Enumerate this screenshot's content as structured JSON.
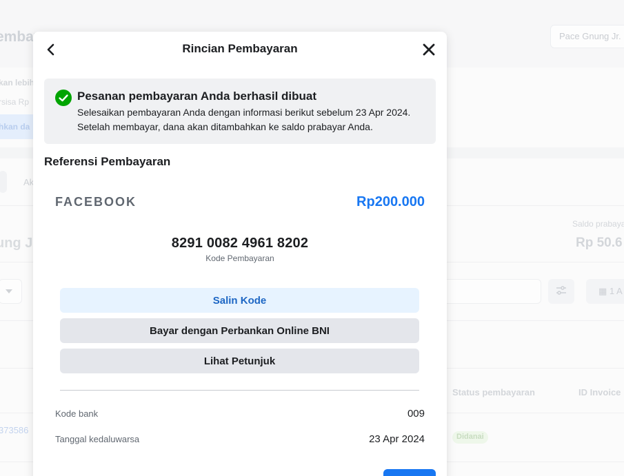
{
  "background": {
    "page_title": "embayaran",
    "user_name": "Pace Gnung Jr.",
    "notice_title": "kan lebih",
    "notice_text": "rsisa Rp",
    "notice_button": "hkan da",
    "tab_label": "Ak",
    "account_name": "ung J",
    "balance_label": "Saldo prabayar",
    "balance_value": "Rp 50.6",
    "date_filter": "1 A",
    "table_headers": [
      "Status pembayaran",
      "ID Invoice"
    ],
    "row_id": "373586",
    "row_status": "Didanai"
  },
  "modal": {
    "title": "Rincian Pembayaran",
    "success": {
      "title": "Pesanan pembayaran Anda berhasil dibuat",
      "text": "Selesaikan pembayaran Anda dengan informasi berikut sebelum 23 Apr 2024. Setelah membayar, dana akan ditambahkan ke saldo prabayar Anda."
    },
    "reference_heading": "Referensi Pembayaran",
    "merchant": "FACEBOOK",
    "amount": "Rp200.000",
    "payment_code": "8291 0082 4961 8202",
    "payment_code_label": "Kode Pembayaran",
    "buttons": {
      "copy": "Salin Kode",
      "bank": "Bayar dengan Perbankan Online BNI",
      "guide": "Lihat Petunjuk"
    },
    "details": [
      {
        "label": "Kode bank",
        "value": "009"
      },
      {
        "label": "Tanggal kedaluwarsa",
        "value": "23 Apr 2024"
      }
    ]
  },
  "colors": {
    "accent": "#1877f2",
    "success": "#00a400",
    "copy_button_bg": "#e7f3ff",
    "secondary_button_bg": "#e4e6eb"
  },
  "icons": {
    "back": "chevron-left-icon",
    "close": "close-icon",
    "success": "check-circle-icon"
  }
}
